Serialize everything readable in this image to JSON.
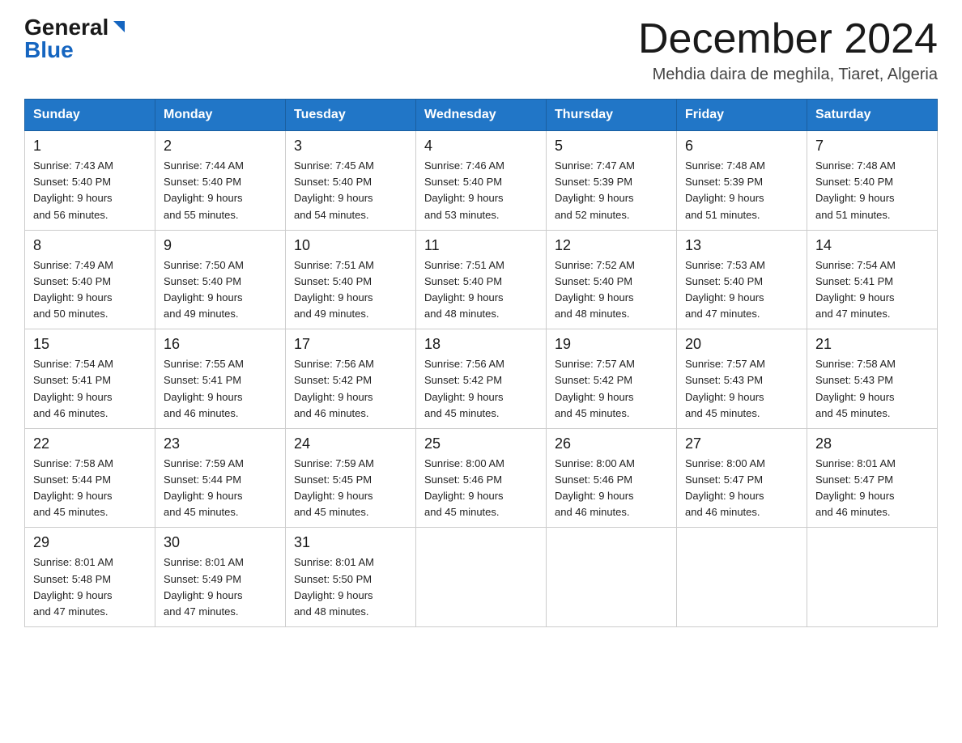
{
  "header": {
    "logo_general": "General",
    "logo_blue": "Blue",
    "month_title": "December 2024",
    "location": "Mehdia daira de meghila, Tiaret, Algeria"
  },
  "weekdays": [
    "Sunday",
    "Monday",
    "Tuesday",
    "Wednesday",
    "Thursday",
    "Friday",
    "Saturday"
  ],
  "weeks": [
    [
      {
        "day": "1",
        "sunrise": "7:43 AM",
        "sunset": "5:40 PM",
        "daylight": "9 hours and 56 minutes."
      },
      {
        "day": "2",
        "sunrise": "7:44 AM",
        "sunset": "5:40 PM",
        "daylight": "9 hours and 55 minutes."
      },
      {
        "day": "3",
        "sunrise": "7:45 AM",
        "sunset": "5:40 PM",
        "daylight": "9 hours and 54 minutes."
      },
      {
        "day": "4",
        "sunrise": "7:46 AM",
        "sunset": "5:40 PM",
        "daylight": "9 hours and 53 minutes."
      },
      {
        "day": "5",
        "sunrise": "7:47 AM",
        "sunset": "5:39 PM",
        "daylight": "9 hours and 52 minutes."
      },
      {
        "day": "6",
        "sunrise": "7:48 AM",
        "sunset": "5:39 PM",
        "daylight": "9 hours and 51 minutes."
      },
      {
        "day": "7",
        "sunrise": "7:48 AM",
        "sunset": "5:40 PM",
        "daylight": "9 hours and 51 minutes."
      }
    ],
    [
      {
        "day": "8",
        "sunrise": "7:49 AM",
        "sunset": "5:40 PM",
        "daylight": "9 hours and 50 minutes."
      },
      {
        "day": "9",
        "sunrise": "7:50 AM",
        "sunset": "5:40 PM",
        "daylight": "9 hours and 49 minutes."
      },
      {
        "day": "10",
        "sunrise": "7:51 AM",
        "sunset": "5:40 PM",
        "daylight": "9 hours and 49 minutes."
      },
      {
        "day": "11",
        "sunrise": "7:51 AM",
        "sunset": "5:40 PM",
        "daylight": "9 hours and 48 minutes."
      },
      {
        "day": "12",
        "sunrise": "7:52 AM",
        "sunset": "5:40 PM",
        "daylight": "9 hours and 48 minutes."
      },
      {
        "day": "13",
        "sunrise": "7:53 AM",
        "sunset": "5:40 PM",
        "daylight": "9 hours and 47 minutes."
      },
      {
        "day": "14",
        "sunrise": "7:54 AM",
        "sunset": "5:41 PM",
        "daylight": "9 hours and 47 minutes."
      }
    ],
    [
      {
        "day": "15",
        "sunrise": "7:54 AM",
        "sunset": "5:41 PM",
        "daylight": "9 hours and 46 minutes."
      },
      {
        "day": "16",
        "sunrise": "7:55 AM",
        "sunset": "5:41 PM",
        "daylight": "9 hours and 46 minutes."
      },
      {
        "day": "17",
        "sunrise": "7:56 AM",
        "sunset": "5:42 PM",
        "daylight": "9 hours and 46 minutes."
      },
      {
        "day": "18",
        "sunrise": "7:56 AM",
        "sunset": "5:42 PM",
        "daylight": "9 hours and 45 minutes."
      },
      {
        "day": "19",
        "sunrise": "7:57 AM",
        "sunset": "5:42 PM",
        "daylight": "9 hours and 45 minutes."
      },
      {
        "day": "20",
        "sunrise": "7:57 AM",
        "sunset": "5:43 PM",
        "daylight": "9 hours and 45 minutes."
      },
      {
        "day": "21",
        "sunrise": "7:58 AM",
        "sunset": "5:43 PM",
        "daylight": "9 hours and 45 minutes."
      }
    ],
    [
      {
        "day": "22",
        "sunrise": "7:58 AM",
        "sunset": "5:44 PM",
        "daylight": "9 hours and 45 minutes."
      },
      {
        "day": "23",
        "sunrise": "7:59 AM",
        "sunset": "5:44 PM",
        "daylight": "9 hours and 45 minutes."
      },
      {
        "day": "24",
        "sunrise": "7:59 AM",
        "sunset": "5:45 PM",
        "daylight": "9 hours and 45 minutes."
      },
      {
        "day": "25",
        "sunrise": "8:00 AM",
        "sunset": "5:46 PM",
        "daylight": "9 hours and 45 minutes."
      },
      {
        "day": "26",
        "sunrise": "8:00 AM",
        "sunset": "5:46 PM",
        "daylight": "9 hours and 46 minutes."
      },
      {
        "day": "27",
        "sunrise": "8:00 AM",
        "sunset": "5:47 PM",
        "daylight": "9 hours and 46 minutes."
      },
      {
        "day": "28",
        "sunrise": "8:01 AM",
        "sunset": "5:47 PM",
        "daylight": "9 hours and 46 minutes."
      }
    ],
    [
      {
        "day": "29",
        "sunrise": "8:01 AM",
        "sunset": "5:48 PM",
        "daylight": "9 hours and 47 minutes."
      },
      {
        "day": "30",
        "sunrise": "8:01 AM",
        "sunset": "5:49 PM",
        "daylight": "9 hours and 47 minutes."
      },
      {
        "day": "31",
        "sunrise": "8:01 AM",
        "sunset": "5:50 PM",
        "daylight": "9 hours and 48 minutes."
      },
      null,
      null,
      null,
      null
    ]
  ],
  "labels": {
    "sunrise": "Sunrise:",
    "sunset": "Sunset:",
    "daylight": "Daylight:"
  }
}
